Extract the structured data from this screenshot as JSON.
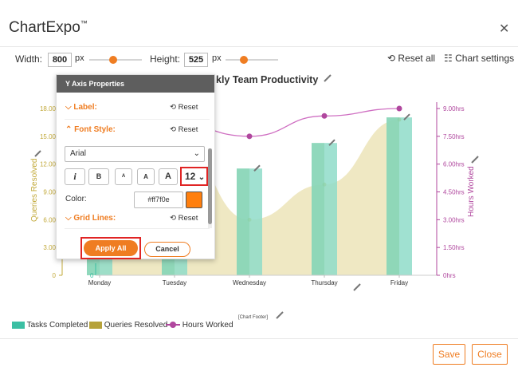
{
  "app": {
    "title": "ChartExpo",
    "trademark": "™"
  },
  "toolbar": {
    "width_label": "Width:",
    "width_value": "800",
    "width_unit": "px",
    "height_label": "Height:",
    "height_value": "525",
    "height_unit": "px",
    "width_slider": 0.45,
    "height_slider": 0.35,
    "reset_all": "Reset all",
    "chart_settings": "Chart settings"
  },
  "panel": {
    "title": "Y Axis Properties",
    "label_section": "Label:",
    "font_style_section": "Font Style:",
    "reset": "Reset",
    "font_family": "Arial",
    "italic_btn": "i",
    "bold_btn": "B",
    "size_btns": [
      "A",
      "A",
      "A"
    ],
    "font_size": "12",
    "color_label": "Color:",
    "color_value": "#ff7f0e",
    "grid_lines_section": "Grid Lines:",
    "apply_all": "Apply All",
    "cancel": "Cancel"
  },
  "chart_data": {
    "type": "bar",
    "title": "Weekly Team Productivity",
    "title_visible": "kly Team Productivity",
    "categories": [
      "Monday",
      "Tuesday",
      "Wednesday",
      "Thursday",
      "Friday"
    ],
    "series": [
      {
        "name": "Tasks Completed",
        "type": "bar",
        "axis": "hidden",
        "values": [
          6.6,
          6.3,
          19.2,
          23.8,
          28.4
        ]
      },
      {
        "name": "Queries Resolved",
        "type": "area",
        "axis": "left",
        "values": [
          15.9,
          15.0,
          6.0,
          9.8,
          16.8
        ]
      },
      {
        "name": "Hours Worked",
        "type": "line",
        "axis": "right",
        "values": [
          7.0,
          8.2,
          7.5,
          8.6,
          9.0
        ]
      }
    ],
    "left_axis": {
      "label": "Queries Resolved",
      "ticks": [
        "0",
        "3.00",
        "6.00",
        "9.00",
        "12.00",
        "15.00",
        "18.00"
      ],
      "ylim": [
        0,
        18
      ]
    },
    "right_axis": {
      "label": "Hours Worked",
      "ticks": [
        "0hrs",
        "1.50hrs",
        "3.00hrs",
        "4.50hrs",
        "6.00hrs",
        "7.50hrs",
        "9.00hrs"
      ],
      "ylim": [
        0,
        9
      ]
    },
    "hidden_axis_tick": "0",
    "footer": "[Chart Footer]",
    "colors": {
      "bars": "#8fdcc9",
      "bars_strong": "#7fcfa8",
      "area": "#ede6bd",
      "area_dot": "#c9b43a",
      "line": "#cf6fc2",
      "line_dot": "#b0479e",
      "left_axis": "#c2a93a",
      "right_axis": "#b0479e"
    }
  },
  "legend": [
    {
      "label": "Tasks Completed",
      "icon": "bar-swatch-icon",
      "color": "#3bbfa3"
    },
    {
      "label": "Queries Resolved",
      "icon": "area-swatch-icon",
      "color": "#b6a23a"
    },
    {
      "label": "Hours Worked",
      "icon": "line-dot-icon",
      "color": "#b0479e"
    }
  ],
  "footer_buttons": {
    "save": "Save",
    "close": "Close"
  }
}
